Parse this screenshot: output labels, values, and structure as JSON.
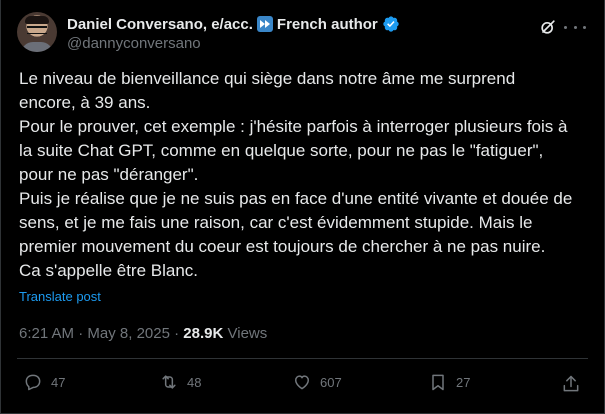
{
  "author": {
    "display_name": "Daniel Conversano, e/acc.",
    "flag_icon": "fast-forward-icon",
    "bio_label": "French author",
    "handle": "@dannyconversano",
    "verified": true,
    "verified_color": "#1d9bf0"
  },
  "tweet": {
    "lines": [
      "Le niveau de bienveillance qui siège dans notre âme me surprend",
      "encore, à 39 ans.",
      "Pour le prouver, cet exemple : j'hésite parfois à interroger plusieurs fois à",
      "la suite Chat GPT, comme en quelque sorte, pour ne pas le \"fatiguer\",",
      "pour ne pas \"déranger\".",
      "Puis je réalise que je ne suis pas en face d'une entité vivante et douée de",
      "sens, et je me fais une raison, car c'est évidemment stupide. Mais le",
      "premier mouvement du coeur est toujours de chercher à ne pas nuire.",
      "Ca s'appelle être Blanc."
    ],
    "translate_label": "Translate post"
  },
  "meta": {
    "time": "6:21 AM",
    "separator": "·",
    "date": "May 8, 2025",
    "views_count": "28.9K",
    "views_label": "Views"
  },
  "actions": {
    "replies": "47",
    "reposts": "48",
    "likes": "607",
    "bookmarks": "27"
  },
  "colors": {
    "background": "#000000",
    "text": "#e7e9ea",
    "muted": "#71767b",
    "accent": "#1d9bf0",
    "border": "#2f3336"
  }
}
